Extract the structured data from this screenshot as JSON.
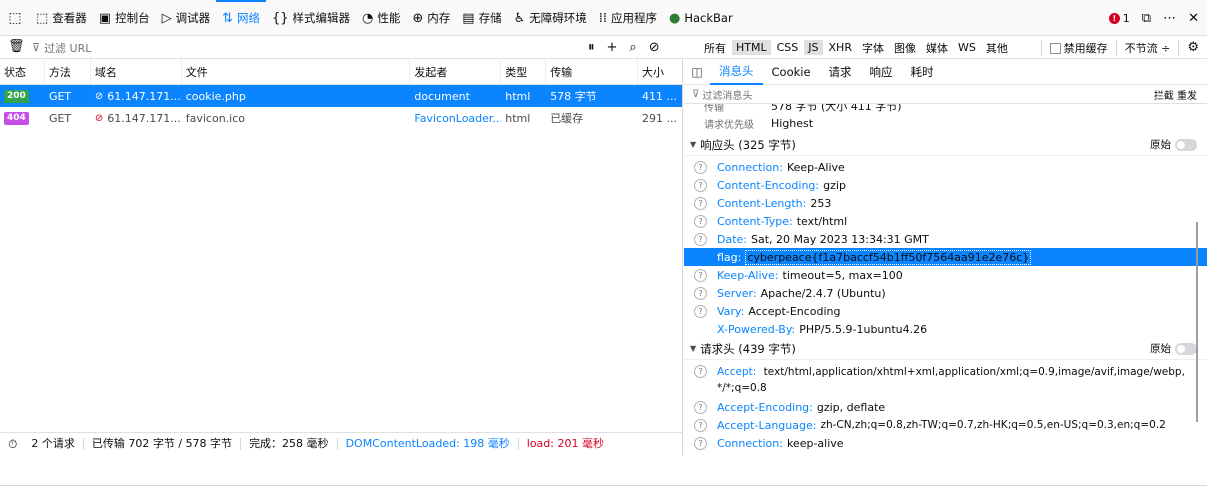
{
  "toolbar": {
    "tabs": [
      {
        "icon": "⬚",
        "label": "查看器"
      },
      {
        "icon": "▣",
        "label": "控制台"
      },
      {
        "icon": "▷",
        "label": "调试器"
      },
      {
        "icon": "⇅",
        "label": "网络"
      },
      {
        "icon": "{}",
        "label": "样式编辑器"
      },
      {
        "icon": "◔",
        "label": "性能"
      },
      {
        "icon": "⊕",
        "label": "内存"
      },
      {
        "icon": "▤",
        "label": "存储"
      },
      {
        "icon": "♿",
        "label": "无障碍环境"
      },
      {
        "icon": "⁞⁞",
        "label": "应用程序"
      },
      {
        "icon": "●",
        "label": "HackBar"
      }
    ],
    "error_count": "1",
    "selected_tab": "网络"
  },
  "filterbar": {
    "placeholder": "过滤 URL",
    "types": [
      "所有",
      "HTML",
      "CSS",
      "JS",
      "XHR",
      "字体",
      "图像",
      "媒体",
      "WS",
      "其他"
    ],
    "disable_cache": "禁用缓存",
    "throttle": "不节流 ÷"
  },
  "table": {
    "headers": [
      "状态",
      "方法",
      "域名",
      "文件",
      "发起者",
      "类型",
      "传输",
      "大小"
    ],
    "rows": [
      {
        "status": "200",
        "method": "GET",
        "domain": "61.147.171....",
        "file": "cookie.php",
        "cause": "document",
        "type": "html",
        "transferred": "578 字节",
        "size": "411 ..."
      },
      {
        "status": "404",
        "method": "GET",
        "domain": "61.147.171....",
        "file": "favicon.ico",
        "cause": "FaviconLoader....",
        "type": "html",
        "transferred": "已缓存",
        "size": "291 ..."
      }
    ]
  },
  "statusbar": {
    "requests": "2 个请求",
    "transferred": "已传输 702 字节 / 578 字节",
    "finish": "完成：258 毫秒",
    "dcl": "DOMContentLoaded: 198 毫秒",
    "load": "load: 201 毫秒"
  },
  "details": {
    "tabs": [
      "消息头",
      "Cookie",
      "请求",
      "响应",
      "耗时"
    ],
    "filter_placeholder": "过滤消息头",
    "actions": "拦截  重发",
    "top_partial": {
      "k1": "传输",
      "v1": "578 字节 (大小 411 字节)",
      "k2": "请求优先级",
      "v2": "Highest"
    },
    "response_section": "响应头 (325 字节)",
    "raw_label": "原始",
    "response_headers": [
      {
        "name": "Connection:",
        "value": "Keep-Alive"
      },
      {
        "name": "Content-Encoding:",
        "value": "gzip"
      },
      {
        "name": "Content-Length:",
        "value": "253"
      },
      {
        "name": "Content-Type:",
        "value": "text/html"
      },
      {
        "name": "Date:",
        "value": "Sat, 20 May 2023 13:34:31 GMT"
      },
      {
        "name": "flag:",
        "value": "cyberpeace{f1a7baccf54b1ff50f7564aa91e2e76c}"
      },
      {
        "name": "Keep-Alive:",
        "value": "timeout=5, max=100"
      },
      {
        "name": "Server:",
        "value": "Apache/2.4.7 (Ubuntu)"
      },
      {
        "name": "Vary:",
        "value": "Accept-Encoding"
      },
      {
        "name": "X-Powered-By:",
        "value": "PHP/5.5.9-1ubuntu4.26"
      }
    ],
    "request_section": "请求头 (439 字节)",
    "request_headers": [
      {
        "name": "Accept:",
        "value": "text/html,application/xhtml+xml,application/xml;q=0.9,image/avif,image/webp,*/*;q=0.8"
      },
      {
        "name": "Accept-Encoding:",
        "value": "gzip, deflate"
      },
      {
        "name": "Accept-Language:",
        "value": "zh-CN,zh;q=0.8,zh-TW;q=0.7,zh-HK;q=0.5,en-US;q=0.3,en;q=0.2"
      },
      {
        "name": "Connection:",
        "value": "keep-alive"
      }
    ]
  }
}
